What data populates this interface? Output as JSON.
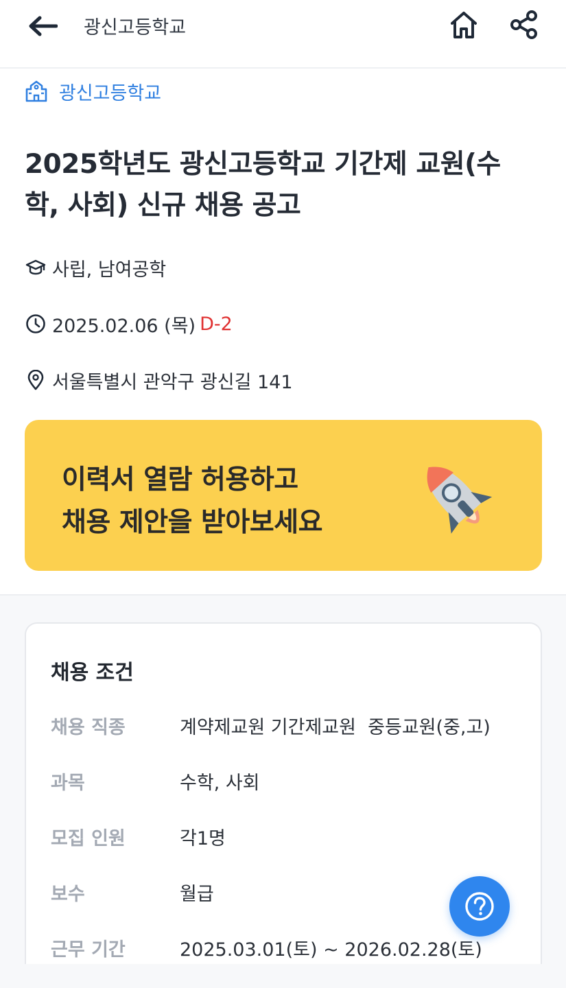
{
  "header": {
    "title": "광신고등학교",
    "back_icon": "arrow-left-icon",
    "home_icon": "home-icon",
    "share_icon": "share-icon"
  },
  "school_link": {
    "icon": "school-building-icon",
    "label": "광신고등학교"
  },
  "post": {
    "title_line1": "2025학년도 광신고등학교 기간제 교원(수",
    "title_line2": "학, 사회) 신규 채용 공고",
    "school_type": "사립, 남여공학",
    "deadline": "2025.02.06 (목)",
    "dday": "D-2",
    "address": "서울특별시 관악구 광신길 141"
  },
  "banner": {
    "line1": "이력서 열람 허용하고",
    "line2": "채용 제안을 받아보세요",
    "icon": "rocket-icon"
  },
  "conditions": {
    "title": "채용 조건",
    "rows": [
      {
        "label": "채용 직종",
        "value": "계약제교원 기간제교원  중등교원(중,고)"
      },
      {
        "label": "과목",
        "value": "수학, 사회"
      },
      {
        "label": "모집 인원",
        "value": "각1명"
      },
      {
        "label": "보수",
        "value": "월급"
      },
      {
        "label": "근무 기간",
        "value": "2025.03.01(토) ~ 2026.02.28(토)"
      }
    ]
  },
  "help_button": {
    "icon": "question-circle-icon"
  },
  "colors": {
    "accent_blue": "#2f7fe0",
    "dday_red": "#e03131",
    "banner_yellow": "#fcd04f",
    "fab_blue": "#2f86ee"
  }
}
